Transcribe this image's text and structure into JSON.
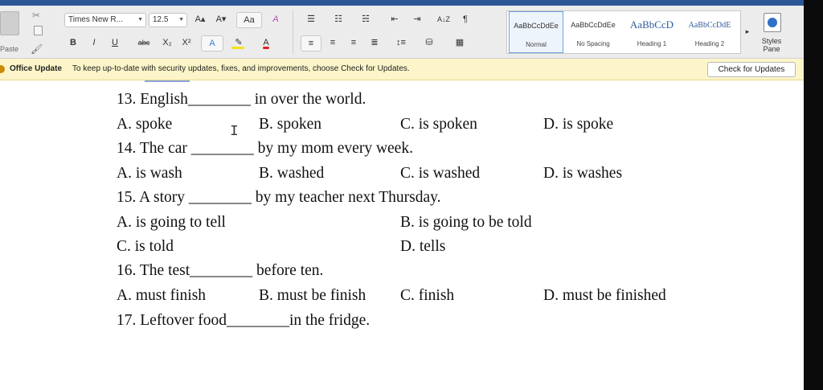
{
  "ribbon": {
    "paste_label": "Paste",
    "font_name": "Times New R...",
    "font_size": "12.5",
    "grow_font": "A▴",
    "shrink_font": "A▾",
    "change_case": "Aa",
    "clear_format": "A",
    "bold": "B",
    "italic": "I",
    "underline": "U",
    "strikethrough": "abc",
    "subscript": "X₂",
    "superscript": "X²",
    "text_effects": "A",
    "font_color": "A",
    "highlight_color": "#f5e21b",
    "font_color_value": "#e02020",
    "sort": "A↓Z",
    "pilcrow": "¶",
    "styles": [
      {
        "sample": "AaBbCcDdEe",
        "name": "Normal",
        "selected": true
      },
      {
        "sample": "AaBbCcDdEe",
        "name": "No Spacing",
        "selected": false
      },
      {
        "sample": "AaBbCcD",
        "name": "Heading 1",
        "selected": false
      },
      {
        "sample": "AaBbCcDdE",
        "name": "Heading 2",
        "selected": false
      }
    ],
    "gallery_more": "▸",
    "styles_pane_label": "Styles Pane",
    "accent_color": "#2f6fc6"
  },
  "update_bar": {
    "title": "Office Update",
    "message": "To keep up-to-date with security updates, fixes, and improvements, choose Check for Updates.",
    "button": "Check for Updates"
  },
  "document": {
    "questions": [
      {
        "stem": "13. English________ in over the world.",
        "options": [
          "A. spoke",
          "B. spoken",
          "C. is spoken",
          "D. is spoke"
        ]
      },
      {
        "stem": "14. The car ________ by my mom every week.",
        "options": [
          "A. is wash",
          "B. washed",
          "C. is washed",
          "D. is washes"
        ]
      },
      {
        "stem": "15. A story ________ by my teacher next Thursday.",
        "options": [
          "A. is going to tell",
          "B. is going to be told",
          "C. is told",
          "D. tells"
        ]
      },
      {
        "stem": "16. The test________ before ten.",
        "options": [
          "A. must finish",
          "B. must be finish",
          "C. finish",
          "D. must be finished"
        ]
      },
      {
        "stem": "17. Leftover food________in the fridge.",
        "options": []
      }
    ],
    "ibeam": "I"
  }
}
